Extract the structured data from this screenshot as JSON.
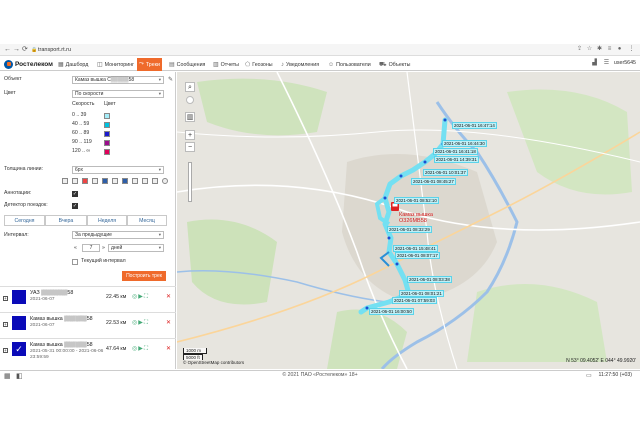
{
  "browser": {
    "url": "transport.rt.ru"
  },
  "header": {
    "logo": "Ростелеком",
    "menu": [
      {
        "label": "Дашборд",
        "icon": "dashboard-icon"
      },
      {
        "label": "Мониторинг",
        "icon": "monitor-icon"
      },
      {
        "label": "Треки",
        "icon": "tracks-icon",
        "active": true
      },
      {
        "label": "Сообщения",
        "icon": "messages-icon"
      },
      {
        "label": "Отчеты",
        "icon": "reports-icon"
      },
      {
        "label": "Геозоны",
        "icon": "geofence-icon"
      },
      {
        "label": "Уведомления",
        "icon": "bell-icon"
      },
      {
        "label": "Пользователи",
        "icon": "users-icon"
      },
      {
        "label": "Объекты",
        "icon": "objects-icon"
      }
    ],
    "user": "user5645"
  },
  "panel": {
    "object_label": "Объект",
    "object_value": "Камаз вышка С▒▒▒▒▒58",
    "color_label": "Цвет",
    "color_value": "По скорости",
    "speed_header": "Скорость",
    "color_header": "Цвет",
    "speed_rows": [
      {
        "range": "0 .. 39",
        "color": "#a6eefa"
      },
      {
        "range": "40 .. 59",
        "color": "#00c2e0"
      },
      {
        "range": "60 .. 89",
        "color": "#1a1acc"
      },
      {
        "range": "90 .. 119",
        "color": "#9b0d8c"
      },
      {
        "range": "120 .. ∞",
        "color": "#e0005a"
      }
    ],
    "line_width_label": "Толщина линии:",
    "line_width_value": "6px",
    "annotations_label": "Аннотации:",
    "trip_detector_label": "Детектор поездок:",
    "periods": [
      "Сегодня",
      "Вчера",
      "Неделя",
      "Месяц"
    ],
    "interval_label": "Интервал:",
    "interval_value": "За предыдущие",
    "interval_count": "7",
    "interval_unit": "дней",
    "current_interval_label": "Текущий интервал",
    "build_button": "Построить трек"
  },
  "tracks": [
    {
      "name": "УАЗ ▒▒▒▒▒▒▒58",
      "date": "2021-06-07",
      "distance": "22.45 км",
      "checked": false
    },
    {
      "name": "Камаз вышка ▒▒▒▒▒▒58",
      "date": "2021-06-07",
      "distance": "22.53 км",
      "checked": false
    },
    {
      "name": "Камаз вышка ▒▒▒▒▒▒58",
      "date": "2021-05-31 00:00:00 - 2021-06-06 23:59:59",
      "distance": "47.64 км",
      "checked": true
    }
  ],
  "map": {
    "labels": [
      "2021-06-01 16:47:14",
      "2021-06-01 16:44:30",
      "2021-06-01 16:41:18",
      "2021-06-01 14:39:31",
      "2021-06-01 10:01:37",
      "2021-06-01 08:45:27",
      "2021-06-01 08:52:10",
      "2021-06-01 08:32:29",
      "2021-06-01 15:48:41",
      "2021-06-01 08:07:17",
      "2021-06-01 08:03:38",
      "2021-06-01 08:01:21",
      "2021-06-01 07:59:03",
      "2021-06-01 16:00:50"
    ],
    "marker_label_1": "Камаз вышка",
    "marker_label_2": "О326МВ58",
    "scale_top": "1000 m",
    "scale_bottom": "5000 ft",
    "attribution": "© OpenStreetMap contributors",
    "coords": "N 53° 09.4052' E 044° 49.9920'"
  },
  "footer": {
    "copyright": "© 2021 ПАО «Ростелеком» 18+",
    "clock": "11:27:50 (+03)"
  }
}
